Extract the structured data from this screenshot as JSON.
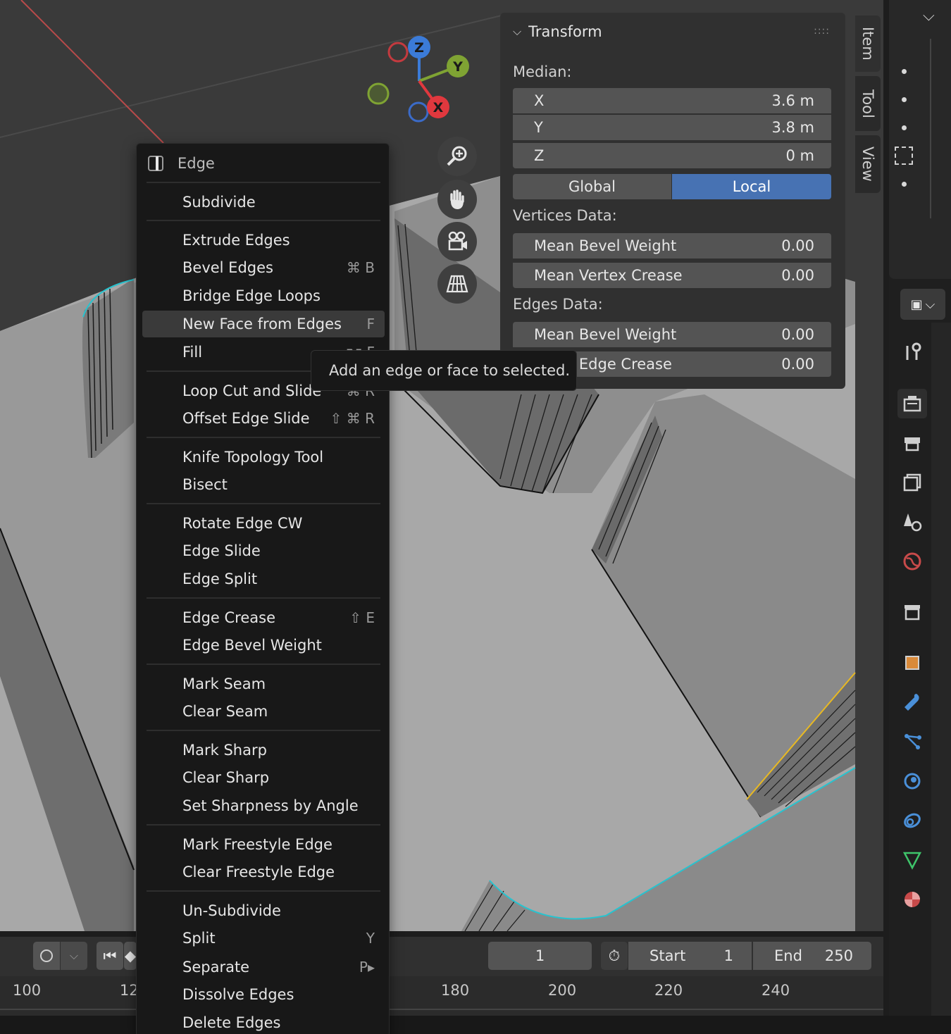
{
  "sidebar": {
    "panel_title": "Transform",
    "grip": "::::",
    "median_label": "Median:",
    "median": [
      {
        "axis": "X",
        "value": "3.6 m"
      },
      {
        "axis": "Y",
        "value": "3.8 m"
      },
      {
        "axis": "Z",
        "value": "0 m"
      }
    ],
    "space_toggle": {
      "global": "Global",
      "local": "Local",
      "active": "Local",
      "active_color": "#4772b3"
    },
    "vertices_label": "Vertices Data:",
    "vertices": [
      {
        "label": "Mean Bevel Weight",
        "value": "0.00"
      },
      {
        "label": "Mean Vertex Crease",
        "value": "0.00"
      }
    ],
    "edges_label": "Edges Data:",
    "edges": [
      {
        "label": "Mean Bevel Weight",
        "value": "0.00"
      },
      {
        "label": "Mean Edge Crease",
        "value": "0.00"
      }
    ],
    "tabs": [
      "Item",
      "Tool",
      "View"
    ]
  },
  "gizmo": {
    "z": "Z",
    "y": "Y",
    "x": "X"
  },
  "menu": {
    "title": "Edge",
    "items": [
      {
        "label": "Subdivide",
        "shortcut": ""
      },
      {
        "label": "Extrude Edges",
        "shortcut": ""
      },
      {
        "label": "Bevel Edges",
        "shortcut": "⌘ B"
      },
      {
        "label": "Bridge Edge Loops",
        "shortcut": ""
      },
      {
        "label": "New Face from Edges",
        "shortcut": "F"
      },
      {
        "label": "Fill",
        "shortcut": "⌥ F"
      },
      {
        "label": "Loop Cut and Slide",
        "shortcut": "⌘ R"
      },
      {
        "label": "Offset Edge Slide",
        "shortcut": "⇧ ⌘ R"
      },
      {
        "label": "Knife Topology Tool",
        "shortcut": ""
      },
      {
        "label": "Bisect",
        "shortcut": ""
      },
      {
        "label": "Rotate Edge CW",
        "shortcut": ""
      },
      {
        "label": "Edge Slide",
        "shortcut": ""
      },
      {
        "label": "Edge Split",
        "shortcut": ""
      },
      {
        "label": "Edge Crease",
        "shortcut": "⇧ E"
      },
      {
        "label": "Edge Bevel Weight",
        "shortcut": ""
      },
      {
        "label": "Mark Seam",
        "shortcut": ""
      },
      {
        "label": "Clear Seam",
        "shortcut": ""
      },
      {
        "label": "Mark Sharp",
        "shortcut": ""
      },
      {
        "label": "Clear Sharp",
        "shortcut": ""
      },
      {
        "label": "Set Sharpness by Angle",
        "shortcut": ""
      },
      {
        "label": "Mark Freestyle Edge",
        "shortcut": ""
      },
      {
        "label": "Clear Freestyle Edge",
        "shortcut": ""
      },
      {
        "label": "Un-Subdivide",
        "shortcut": ""
      },
      {
        "label": "Split",
        "shortcut": "Y"
      },
      {
        "label": "Separate",
        "shortcut": "P▸"
      },
      {
        "label": "Dissolve Edges",
        "shortcut": ""
      },
      {
        "label": "Delete Edges",
        "shortcut": ""
      }
    ],
    "highlighted": "New Face from Edges"
  },
  "tooltip": "Add an edge or face to selected.",
  "timeline": {
    "current_frame": "1",
    "start_label": "Start",
    "start": "1",
    "end_label": "End",
    "end": "250",
    "ruler": [
      "100",
      "12",
      "180",
      "200",
      "220",
      "240"
    ]
  },
  "colors": {
    "selected_edge": "#27c3cf",
    "active_edge": "#e8b923",
    "axis_x": "#e0383e",
    "axis_y": "#7fa333",
    "axis_z": "#3b7bd8"
  }
}
